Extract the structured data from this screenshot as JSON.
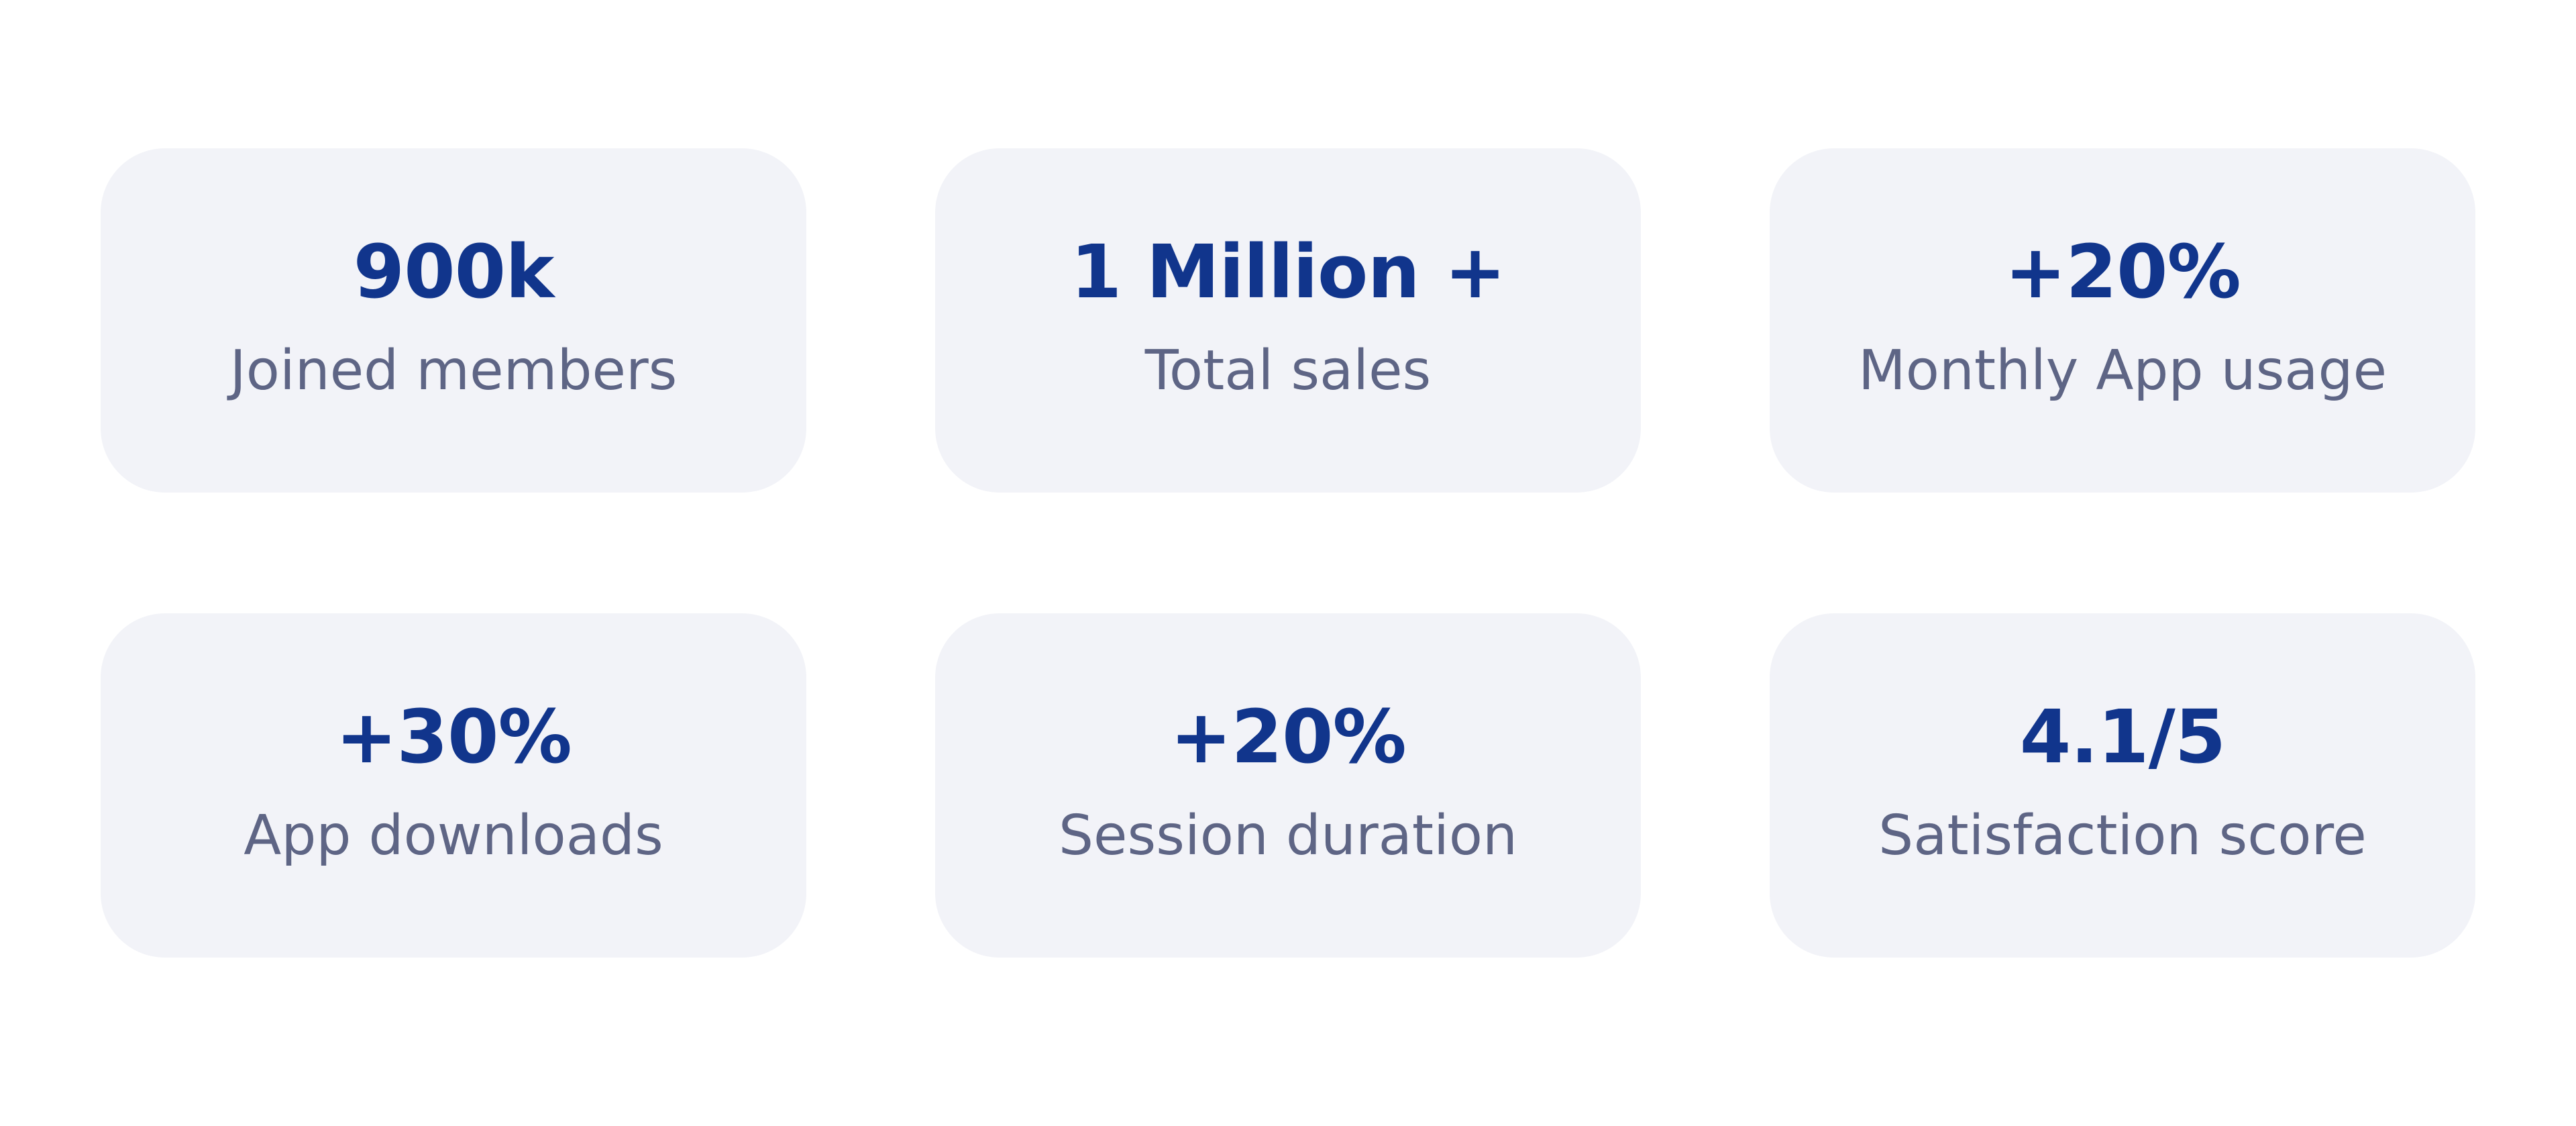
{
  "stats": [
    {
      "value": "900k",
      "label": "Joined members"
    },
    {
      "value": "1 Million +",
      "label": "Total sales"
    },
    {
      "value": "+20%",
      "label": "Monthly App usage"
    },
    {
      "value": "+30%",
      "label": "App downloads"
    },
    {
      "value": "+20%",
      "label": "Session duration"
    },
    {
      "value": "4.1/5",
      "label": "Satisfaction score"
    }
  ],
  "colors": {
    "background": "#ffffff",
    "card": "#f2f3f8",
    "value": "#11358c",
    "label": "#5e6585"
  }
}
